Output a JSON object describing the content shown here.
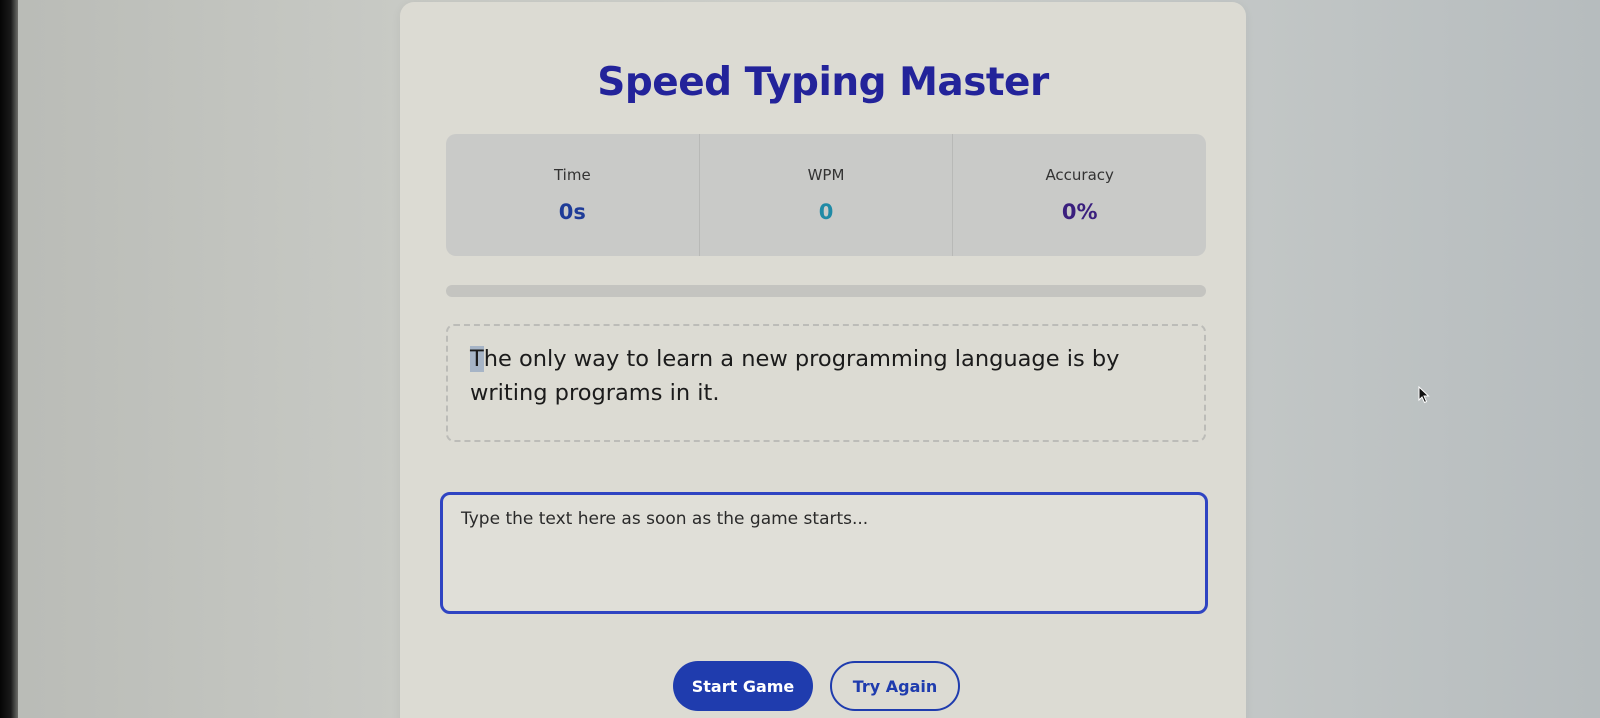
{
  "app": {
    "title": "Speed Typing Master"
  },
  "stats": [
    {
      "label": "Time",
      "value": "0s"
    },
    {
      "label": "WPM",
      "value": "0"
    },
    {
      "label": "Accuracy",
      "value": "0%"
    }
  ],
  "progress": {
    "fraction": 0
  },
  "quote": {
    "first_char": "T",
    "rest": "he only way to learn a new programming language is by writing programs in it."
  },
  "input": {
    "placeholder": "Type the text here as soon as the game starts...",
    "value": ""
  },
  "buttons": {
    "start_label": "Start Game",
    "retry_label": "Try Again"
  },
  "colors": {
    "accent": "#1f3cae",
    "title": "#23239a",
    "wpm": "#1f8aa6"
  }
}
